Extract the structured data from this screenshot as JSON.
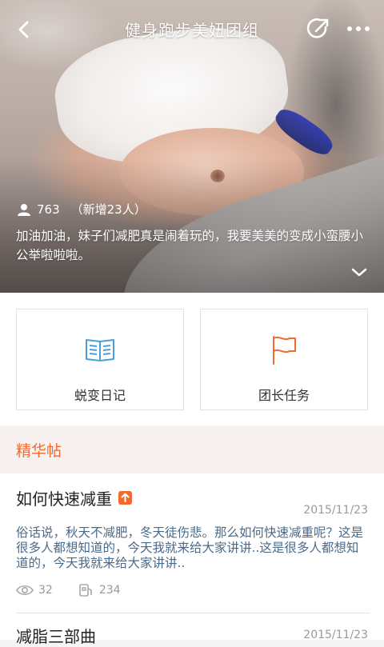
{
  "header": {
    "title": "健身跑步美妞团组"
  },
  "group": {
    "member_count": "763",
    "new_members": "（新增23人）",
    "description": "加油加油，妹子们减肥真是闹着玩的，我要美美的变成小蛮腰小公举啦啦啦。"
  },
  "cards": [
    {
      "label": "蜕变日记",
      "icon": "book-icon"
    },
    {
      "label": "团长任务",
      "icon": "flag-icon"
    }
  ],
  "section": {
    "title": "精华帖"
  },
  "posts": [
    {
      "title": "如何快速减重",
      "date": "2015/11/23",
      "body": "俗话说，秋天不减肥，冬天徒伤悲。那么如何快速减重呢？这是很多人都想知道的，今天我就来给大家讲讲..这是很多人都想知道的，今天我就来给大家讲讲..",
      "views": "32",
      "replies": "234"
    },
    {
      "title": "减脂三部曲",
      "date": "2015/11/23"
    }
  ],
  "colors": {
    "accent": "#f26a2e",
    "icon_blue": "#4a9fd8",
    "link_blue": "#4a6a8a"
  }
}
